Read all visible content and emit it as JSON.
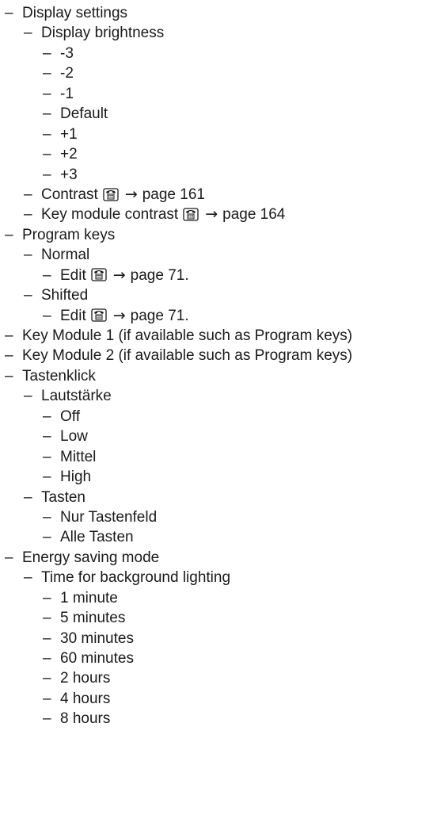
{
  "menu": [
    {
      "depth": 0,
      "label": "Display settings"
    },
    {
      "depth": 1,
      "label": "Display brightness"
    },
    {
      "depth": 2,
      "label": "-3"
    },
    {
      "depth": 2,
      "label": "-2"
    },
    {
      "depth": 2,
      "label": "-1"
    },
    {
      "depth": 2,
      "label": "Default"
    },
    {
      "depth": 2,
      "label": "+1"
    },
    {
      "depth": 2,
      "label": "+2"
    },
    {
      "depth": 2,
      "label": "+3"
    },
    {
      "depth": 1,
      "label": "Contrast",
      "ref": "page 161",
      "icon": "phone-icon"
    },
    {
      "depth": 1,
      "label": "Key module contrast",
      "ref": "page 164",
      "icon": "phone-icon"
    },
    {
      "depth": 0,
      "label": "Program keys"
    },
    {
      "depth": 1,
      "label": "Normal"
    },
    {
      "depth": 2,
      "label": "Edit",
      "ref": "page 71.",
      "icon": "phone-icon"
    },
    {
      "depth": 1,
      "label": "Shifted"
    },
    {
      "depth": 2,
      "label": "Edit",
      "ref": "page 71.",
      "icon": "phone-icon"
    },
    {
      "depth": 0,
      "label": "Key Module 1 (if available such as Program keys)"
    },
    {
      "depth": 0,
      "label": "Key Module 2 (if available such as Program keys)"
    },
    {
      "depth": 0,
      "label": "Tastenklick"
    },
    {
      "depth": 1,
      "label": "Lautstärke"
    },
    {
      "depth": 2,
      "label": "Off"
    },
    {
      "depth": 2,
      "label": "Low"
    },
    {
      "depth": 2,
      "label": "Mittel"
    },
    {
      "depth": 2,
      "label": "High"
    },
    {
      "depth": 1,
      "label": "Tasten"
    },
    {
      "depth": 2,
      "label": "Nur Tastenfeld"
    },
    {
      "depth": 2,
      "label": "Alle Tasten"
    },
    {
      "depth": 0,
      "label": "Energy saving mode"
    },
    {
      "depth": 1,
      "label": "Time for background lighting"
    },
    {
      "depth": 2,
      "label": "1 minute"
    },
    {
      "depth": 2,
      "label": "5 minutes"
    },
    {
      "depth": 2,
      "label": "30 minutes"
    },
    {
      "depth": 2,
      "label": "60 minutes"
    },
    {
      "depth": 2,
      "label": "2 hours"
    },
    {
      "depth": 2,
      "label": "4 hours"
    },
    {
      "depth": 2,
      "label": "8 hours"
    }
  ],
  "dash_glyph": "–",
  "arrow_glyph": "→"
}
